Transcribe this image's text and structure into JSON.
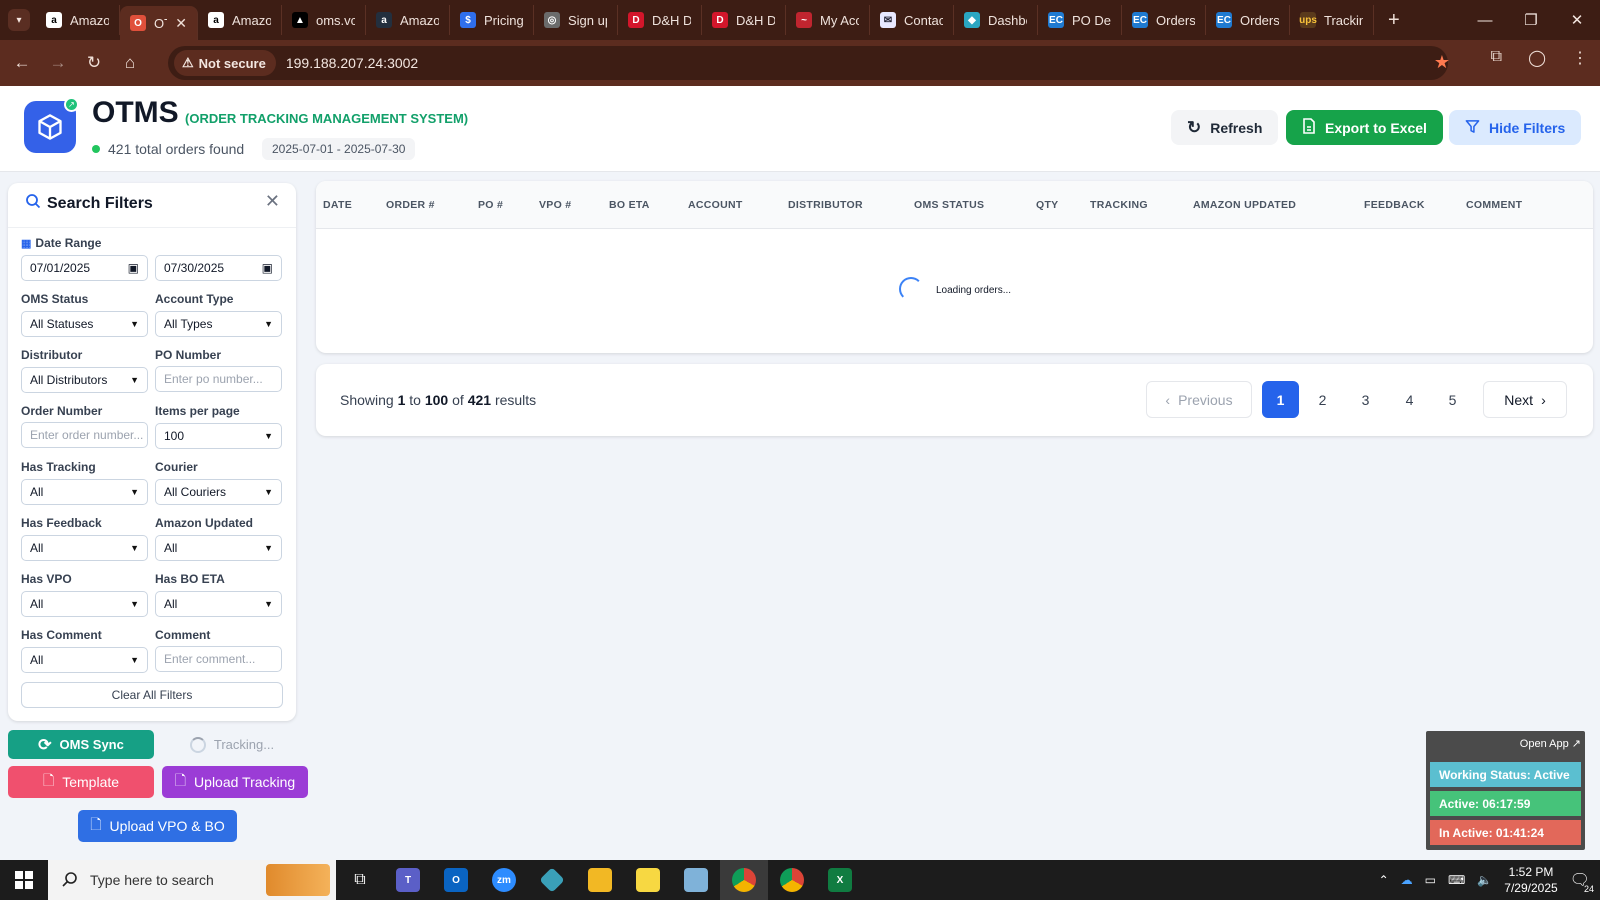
{
  "browser": {
    "tabs": [
      {
        "title": "Amazon",
        "fav": "a",
        "color": "#ffffff",
        "fg": "#000"
      },
      {
        "title": "OTMS",
        "fav": "O",
        "color": "#e0503b",
        "fg": "#fff",
        "active": true
      },
      {
        "title": "Amazon",
        "fav": "a",
        "color": "#ffffff",
        "fg": "#000"
      },
      {
        "title": "oms.vc",
        "fav": "▲",
        "color": "#000000",
        "fg": "#fff"
      },
      {
        "title": "Amazon",
        "fav": "a",
        "color": "#232f3e",
        "fg": "#fff"
      },
      {
        "title": "Pricing",
        "fav": "$",
        "color": "#2f6fed",
        "fg": "#fff"
      },
      {
        "title": "Sign up",
        "fav": "◎",
        "color": "#6b6b6b",
        "fg": "#fff"
      },
      {
        "title": "D&H D",
        "fav": "D",
        "color": "#d3162b",
        "fg": "#fff"
      },
      {
        "title": "D&H D",
        "fav": "D",
        "color": "#d3162b",
        "fg": "#fff"
      },
      {
        "title": "My Acc",
        "fav": "~",
        "color": "#c0252f",
        "fg": "#fff"
      },
      {
        "title": "Contac",
        "fav": "✉",
        "color": "#e8e8ff",
        "fg": "#223"
      },
      {
        "title": "Dashbo",
        "fav": "◆",
        "color": "#2aa6c2",
        "fg": "#fff"
      },
      {
        "title": "PO Det",
        "fav": "EC",
        "color": "#1f7ad1",
        "fg": "#fff"
      },
      {
        "title": "Orders",
        "fav": "EC",
        "color": "#1f7ad1",
        "fg": "#fff"
      },
      {
        "title": "Orders",
        "fav": "EC",
        "color": "#1f7ad1",
        "fg": "#fff"
      },
      {
        "title": "Trackin",
        "fav": "ups",
        "color": "#5a3a1c",
        "fg": "#f8c13a"
      }
    ],
    "not_secure": "Not secure",
    "url": "199.188.207.24:3002"
  },
  "header": {
    "brand": "OTMS",
    "subtitle": "(ORDER TRACKING MANAGEMENT SYSTEM)",
    "count_text": "421 total orders found",
    "date_range": "2025-07-01 - 2025-07-30",
    "refresh": "Refresh",
    "export": "Export to Excel",
    "hide_filters": "Hide Filters"
  },
  "filters": {
    "title": "Search Filters",
    "date_range_label": "Date Range",
    "date_from": "07/01/2025",
    "date_to": "07/30/2025",
    "oms_status_label": "OMS Status",
    "oms_status_value": "All Statuses",
    "account_type_label": "Account Type",
    "account_type_value": "All Types",
    "distributor_label": "Distributor",
    "distributor_value": "All Distributors",
    "po_number_label": "PO Number",
    "po_number_placeholder": "Enter po number...",
    "order_number_label": "Order Number",
    "order_number_placeholder": "Enter order number...",
    "items_per_page_label": "Items per page",
    "items_per_page_value": "100",
    "has_tracking_label": "Has Tracking",
    "has_tracking_value": "All",
    "courier_label": "Courier",
    "courier_value": "All Couriers",
    "has_feedback_label": "Has Feedback",
    "has_feedback_value": "All",
    "amazon_updated_label": "Amazon Updated",
    "amazon_updated_value": "All",
    "has_vpo_label": "Has VPO",
    "has_vpo_value": "All",
    "has_bo_eta_label": "Has BO ETA",
    "has_bo_eta_value": "All",
    "has_comment_label": "Has Comment",
    "has_comment_value": "All",
    "comment_label": "Comment",
    "comment_placeholder": "Enter comment...",
    "clear_all": "Clear All Filters"
  },
  "actions": {
    "oms_sync": "OMS Sync",
    "tracking": "Tracking...",
    "template": "Template",
    "upload_tracking": "Upload Tracking",
    "upload_vpo_bo": "Upload VPO & BO"
  },
  "table": {
    "columns": [
      "DATE",
      "ORDER #",
      "PO #",
      "VPO #",
      "BO ETA",
      "ACCOUNT",
      "DISTRIBUTOR",
      "OMS STATUS",
      "QTY",
      "TRACKING",
      "AMAZON UPDATED",
      "FEEDBACK",
      "COMMENT"
    ],
    "loading": "Loading orders..."
  },
  "pagination": {
    "showing_prefix": "Showing",
    "from": "1",
    "to_word": "to",
    "to": "100",
    "of_word": "of",
    "total": "421",
    "results_word": "results",
    "previous": "Previous",
    "pages": [
      "1",
      "2",
      "3",
      "4",
      "5"
    ],
    "current_page": "1",
    "next": "Next"
  },
  "status_widget": {
    "open_app": "Open App ↗",
    "working_status": "Working Status: Active",
    "active": "Active: 06:17:59",
    "inactive": "In Active: 01:41:24"
  },
  "taskbar": {
    "search_placeholder": "Type here to search",
    "time": "1:52 PM",
    "date": "7/29/2025",
    "notifications": "24"
  }
}
